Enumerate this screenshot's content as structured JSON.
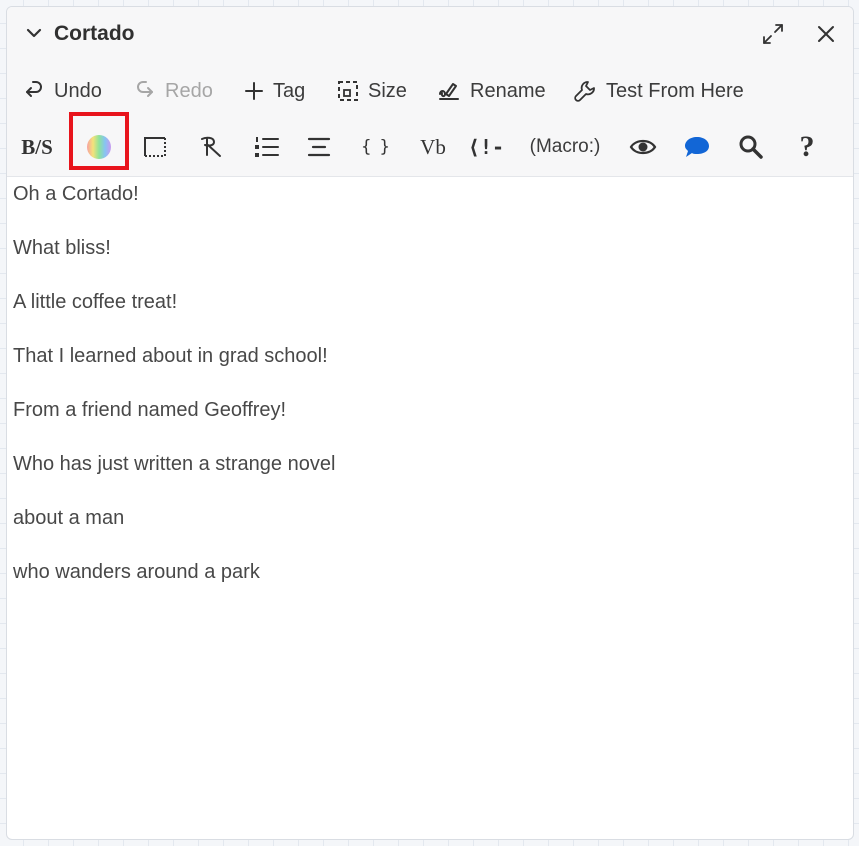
{
  "window": {
    "title": "Cortado",
    "collapse_icon": "chevron-down-icon",
    "maximize_icon": "expand-icon",
    "close_icon": "close-icon"
  },
  "toolbar": {
    "undo": "Undo",
    "redo": "Redo",
    "tag": "Tag",
    "size": "Size",
    "rename": "Rename",
    "test_from_here": "Test From Here",
    "redo_disabled": true
  },
  "format_toolbar": {
    "bold_strike_label": "B/S",
    "verbatim_label": "Vb",
    "comment_label": "⟨!-",
    "braces_label": "{ }",
    "macro_label": "(Macro:)",
    "help_label": "?",
    "highlighted_tool": "color-picker-button",
    "highlight_color": "#e8141c",
    "speech_bubble_color": "#1266d6"
  },
  "editor": {
    "lines": [
      "Oh a Cortado!",
      "What bliss!",
      "A little coffee treat!",
      "That I learned about in grad school!",
      "From a friend named Geoffrey!",
      "Who has just written a strange novel",
      "about a man",
      "who wanders around a park"
    ]
  }
}
